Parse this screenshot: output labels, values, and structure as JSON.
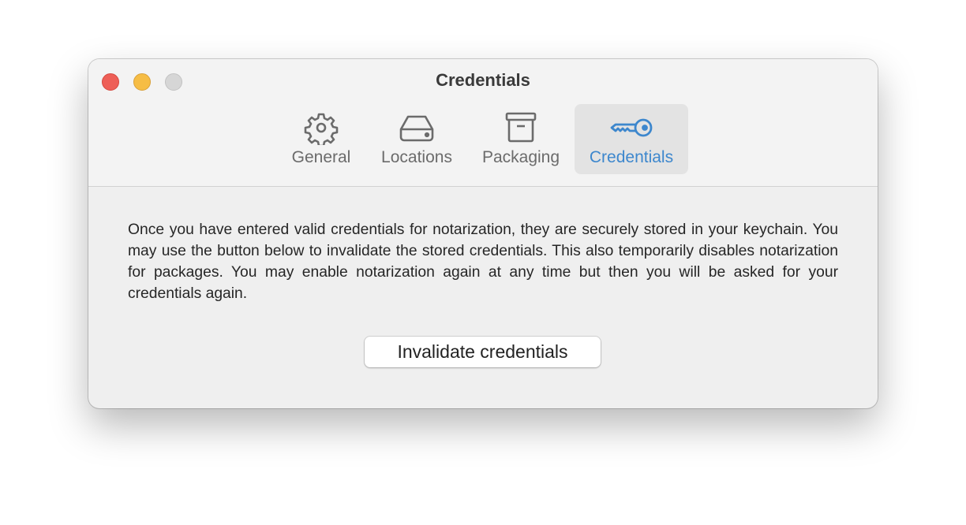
{
  "window": {
    "title": "Credentials"
  },
  "tabs": [
    {
      "label": "General",
      "icon": "gear-icon"
    },
    {
      "label": "Locations",
      "icon": "drive-icon"
    },
    {
      "label": "Packaging",
      "icon": "archive-box-icon"
    },
    {
      "label": "Credentials",
      "icon": "key-icon",
      "active": true
    }
  ],
  "content": {
    "description": "Once you have entered valid credentials for notarization, they are securely stored in your keychain. You may use the button below to invalidate the stored credentials. This also temporarily disables notarization for packages. You may enable notarization again at any time but then you will be asked for your credentials again.",
    "invalidate_label": "Invalidate credentials"
  },
  "colors": {
    "accent": "#3d87cd",
    "close": "#ee5f57",
    "minimize": "#f6bd45",
    "zoom": "#d6d6d6"
  }
}
